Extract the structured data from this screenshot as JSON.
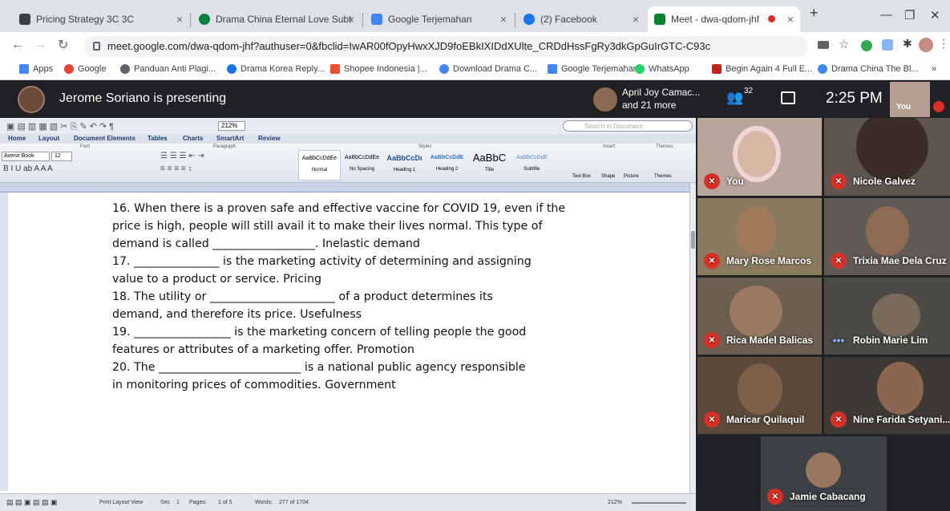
{
  "tabs": [
    {
      "label": "Pricing Strategy 3C 3C",
      "color": "#3c4043"
    },
    {
      "label": "Drama China Eternal Love Subt",
      "color": "#0b8043"
    },
    {
      "label": "Google Terjemahan",
      "color": "#4285f4"
    },
    {
      "label": "(2) Facebook",
      "color": "#1877f2"
    },
    {
      "label": "Meet - dwa-qdom-jhf",
      "color": "#00832d"
    }
  ],
  "window_controls": {
    "new_tab": "+",
    "minimize": "—",
    "restore": "❐",
    "close": "✕"
  },
  "url": "meet.google.com/dwa-qdom-jhf?authuser=0&fbclid=IwAR00fOpyHwxXJD9foEBkIXIDdXUlte_CRDdHssFgRy3dkGpGuIrGTC-C93c",
  "bookmarks": [
    "Apps",
    "Google",
    "Panduan Anti Plagi...",
    "Drama Korea Reply...",
    "Shopee Indonesia |...",
    "Download Drama C...",
    "Google Terjemahan",
    "WhatsApp",
    "Begin Again 4 Full E...",
    "Drama China The Bl..."
  ],
  "bookmarks_more": "»",
  "meet": {
    "presenting": "Jerome Soriano is presenting",
    "others_line1": "April Joy Camac...",
    "others_line2": "and 21 more",
    "participant_count": "32",
    "time": "2:25 PM",
    "self_label": "You"
  },
  "word": {
    "ribbon_tabs": [
      "Home",
      "Layout",
      "Document Elements",
      "Tables",
      "Charts",
      "SmartArt",
      "Review"
    ],
    "group_labels": [
      "Font",
      "Paragraph",
      "Styles",
      "Insert",
      "Themes"
    ],
    "font_name": "Avenir Book",
    "font_size": "12",
    "zoom": "212%",
    "search_placeholder": "Search in Document",
    "styles": [
      {
        "preview": "AaBbCcDdEe",
        "name": "Normal"
      },
      {
        "preview": "AaBbCcDdEe",
        "name": "No Spacing"
      },
      {
        "preview": "AaBbCcDı",
        "name": "Heading 1"
      },
      {
        "preview": "AaBbCcDdE",
        "name": "Heading 2"
      },
      {
        "preview": "AaBbC",
        "name": "Title"
      },
      {
        "preview": "AaBbCcDdE",
        "name": "Subtitle"
      }
    ],
    "insert_items": [
      "Text Box",
      "Shape",
      "Picture",
      "Themes"
    ],
    "lines": [
      "16. When there is a proven safe and effective vaccine for COVID 19, even if the",
      "price is high, people will still avail it to make their lives normal. This type of",
      "demand is called __________________. Inelastic demand",
      "17. _______________ is the marketing activity of determining and assigning",
      "value to a product or service. Pricing",
      "18. The utility or ______________________ of a product determines its",
      "demand, and therefore its price. Usefulness",
      "19. _________________ is the marketing concern of telling people the good",
      "features or attributes of a marketing offer. Promotion",
      "20. The _________________________ is a national public agency responsible",
      "in monitoring prices of commodities. Government"
    ],
    "status": {
      "view": "Print Layout View",
      "sec_label": "Sec",
      "sec": "1",
      "pages_label": "Pages:",
      "pages": "1 of 5",
      "words_label": "Words:",
      "words": "277 of 1704",
      "zoom": "212%"
    }
  },
  "participants": [
    {
      "name": "You",
      "muted": true
    },
    {
      "name": "Nicole Galvez",
      "muted": true
    },
    {
      "name": "Mary Rose Marcos",
      "muted": true
    },
    {
      "name": "Trixia Mae Dela Cruz",
      "muted": true
    },
    {
      "name": "Rica Madel Balicas",
      "muted": true
    },
    {
      "name": "Robin Marie Lim",
      "muted": false
    },
    {
      "name": "Maricar Quilaquil",
      "muted": true
    },
    {
      "name": "Nine Farida Setyani...",
      "muted": true
    },
    {
      "name": "Jamie Cabacang",
      "muted": true
    }
  ]
}
